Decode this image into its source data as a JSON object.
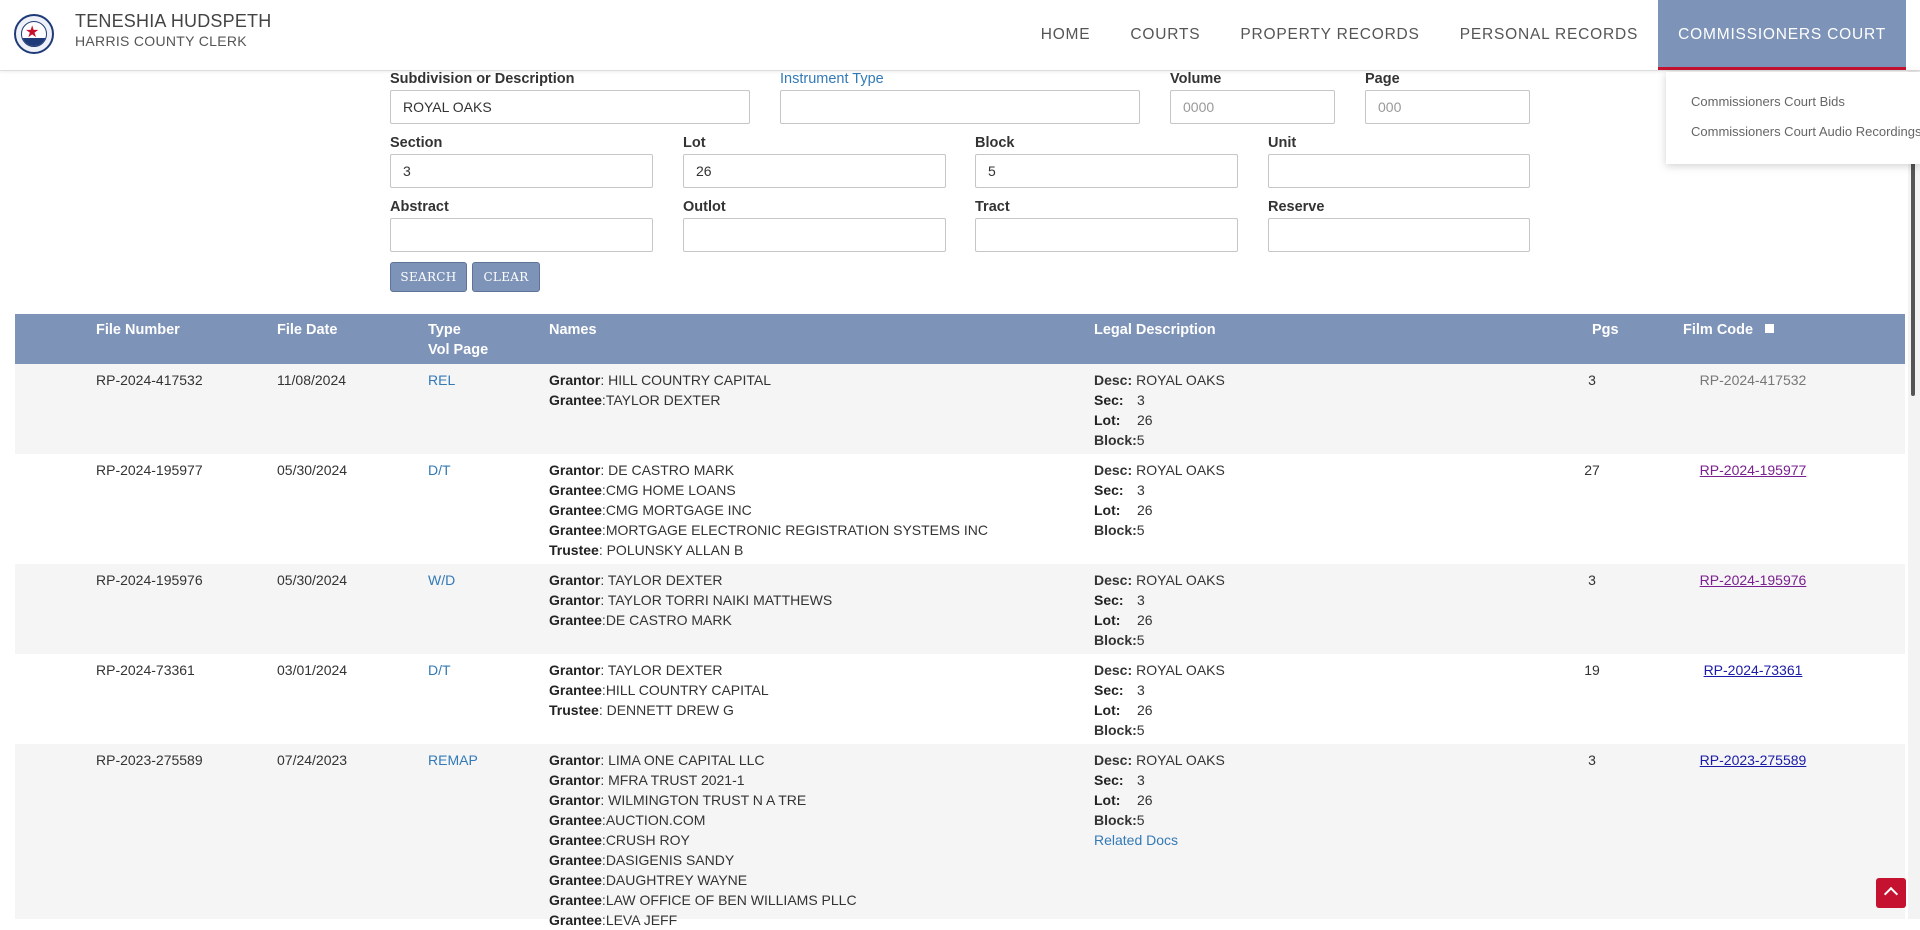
{
  "header": {
    "name": "TENESHIA HUDSPETH",
    "subtitle": "HARRIS COUNTY CLERK",
    "nav": [
      "HOME",
      "COURTS",
      "PROPERTY RECORDS",
      "PERSONAL RECORDS",
      "COMMISSIONERS COURT"
    ],
    "active_nav": "COMMISSIONERS COURT",
    "dropdown": [
      "Commissioners Court Bids",
      "Commissioners Court Audio Recordings"
    ]
  },
  "form": {
    "subdivision": {
      "label": "Subdivision or Description",
      "value": "ROYAL OAKS"
    },
    "instrument_type": {
      "label": "Instrument Type",
      "value": ""
    },
    "volume": {
      "label": "Volume",
      "placeholder": "0000"
    },
    "page": {
      "label": "Page",
      "placeholder": "000"
    },
    "section": {
      "label": "Section",
      "value": "3"
    },
    "lot": {
      "label": "Lot",
      "value": "26"
    },
    "block": {
      "label": "Block",
      "value": "5"
    },
    "unit": {
      "label": "Unit",
      "value": ""
    },
    "abstract": {
      "label": "Abstract",
      "value": ""
    },
    "outlot": {
      "label": "Outlot",
      "value": ""
    },
    "tract": {
      "label": "Tract",
      "value": ""
    },
    "reserve": {
      "label": "Reserve",
      "value": ""
    },
    "search_label": "SEARCH",
    "clear_label": "CLEAR"
  },
  "table": {
    "headers": {
      "file_number": "File Number",
      "file_date": "File Date",
      "type": "Type",
      "vol_page": "Vol Page",
      "names": "Names",
      "legal": "Legal Description",
      "pgs": "Pgs",
      "film_code": "Film Code"
    },
    "legal_labels": {
      "desc": "Desc:",
      "sec": "Sec:",
      "lot": "Lot:",
      "block": "Block:"
    },
    "related_docs_label": "Related Docs",
    "rows": [
      {
        "file_number": "RP-2024-417532",
        "file_date": "11/08/2024",
        "type": "REL",
        "names": [
          {
            "role": "Grantor",
            "sep": ": ",
            "name": "HILL COUNTRY CAPITAL"
          },
          {
            "role": "Grantee",
            "sep": ":",
            "name": "TAYLOR DEXTER"
          }
        ],
        "legal": {
          "desc": "ROYAL OAKS",
          "sec": "3",
          "lot": "26",
          "block": "5"
        },
        "pgs": "3",
        "film_code": "RP-2024-417532",
        "film_style": "plain"
      },
      {
        "file_number": "RP-2024-195977",
        "file_date": "05/30/2024",
        "type": "D/T",
        "names": [
          {
            "role": "Grantor",
            "sep": ": ",
            "name": "DE CASTRO MARK"
          },
          {
            "role": "Grantee",
            "sep": ":",
            "name": "CMG HOME LOANS"
          },
          {
            "role": "Grantee",
            "sep": ":",
            "name": "CMG MORTGAGE INC"
          },
          {
            "role": "Grantee",
            "sep": ":",
            "name": "MORTGAGE ELECTRONIC REGISTRATION SYSTEMS INC"
          },
          {
            "role": "Trustee",
            "sep": ": ",
            "name": "POLUNSKY ALLAN B"
          }
        ],
        "legal": {
          "desc": "ROYAL OAKS",
          "sec": "3",
          "lot": "26",
          "block": "5"
        },
        "pgs": "27",
        "film_code": "RP-2024-195977",
        "film_style": "visited"
      },
      {
        "file_number": "RP-2024-195976",
        "file_date": "05/30/2024",
        "type": "W/D",
        "names": [
          {
            "role": "Grantor",
            "sep": ": ",
            "name": "TAYLOR DEXTER"
          },
          {
            "role": "Grantor",
            "sep": ": ",
            "name": "TAYLOR TORRI NAIKI MATTHEWS"
          },
          {
            "role": "Grantee",
            "sep": ":",
            "name": "DE CASTRO MARK"
          }
        ],
        "legal": {
          "desc": "ROYAL OAKS",
          "sec": "3",
          "lot": "26",
          "block": "5"
        },
        "pgs": "3",
        "film_code": "RP-2024-195976",
        "film_style": "visited"
      },
      {
        "file_number": "RP-2024-73361",
        "file_date": "03/01/2024",
        "type": "D/T",
        "names": [
          {
            "role": "Grantor",
            "sep": ": ",
            "name": "TAYLOR DEXTER"
          },
          {
            "role": "Grantee",
            "sep": ":",
            "name": "HILL COUNTRY CAPITAL"
          },
          {
            "role": "Trustee",
            "sep": ": ",
            "name": "DENNETT DREW G"
          }
        ],
        "legal": {
          "desc": "ROYAL OAKS",
          "sec": "3",
          "lot": "26",
          "block": "5"
        },
        "pgs": "19",
        "film_code": "RP-2024-73361",
        "film_style": "link"
      },
      {
        "file_number": "RP-2023-275589",
        "file_date": "07/24/2023",
        "type": "REMAP",
        "names": [
          {
            "role": "Grantor",
            "sep": ": ",
            "name": "LIMA ONE CAPITAL LLC"
          },
          {
            "role": "Grantor",
            "sep": ": ",
            "name": "MFRA TRUST 2021-1"
          },
          {
            "role": "Grantor",
            "sep": ": ",
            "name": "WILMINGTON TRUST N A TRE"
          },
          {
            "role": "Grantee",
            "sep": ":",
            "name": "AUCTION.COM"
          },
          {
            "role": "Grantee",
            "sep": ":",
            "name": "CRUSH ROY"
          },
          {
            "role": "Grantee",
            "sep": ":",
            "name": "DASIGENIS SANDY"
          },
          {
            "role": "Grantee",
            "sep": ":",
            "name": "DAUGHTREY WAYNE"
          },
          {
            "role": "Grantee",
            "sep": ":",
            "name": "LAW OFFICE OF BEN WILLIAMS PLLC"
          },
          {
            "role": "Grantee",
            "sep": ":",
            "name": "LEVA JEFF"
          }
        ],
        "legal": {
          "desc": "ROYAL OAKS",
          "sec": "3",
          "lot": "26",
          "block": "5",
          "related": true
        },
        "pgs": "3",
        "film_code": "RP-2023-275589",
        "film_style": "link"
      }
    ]
  }
}
